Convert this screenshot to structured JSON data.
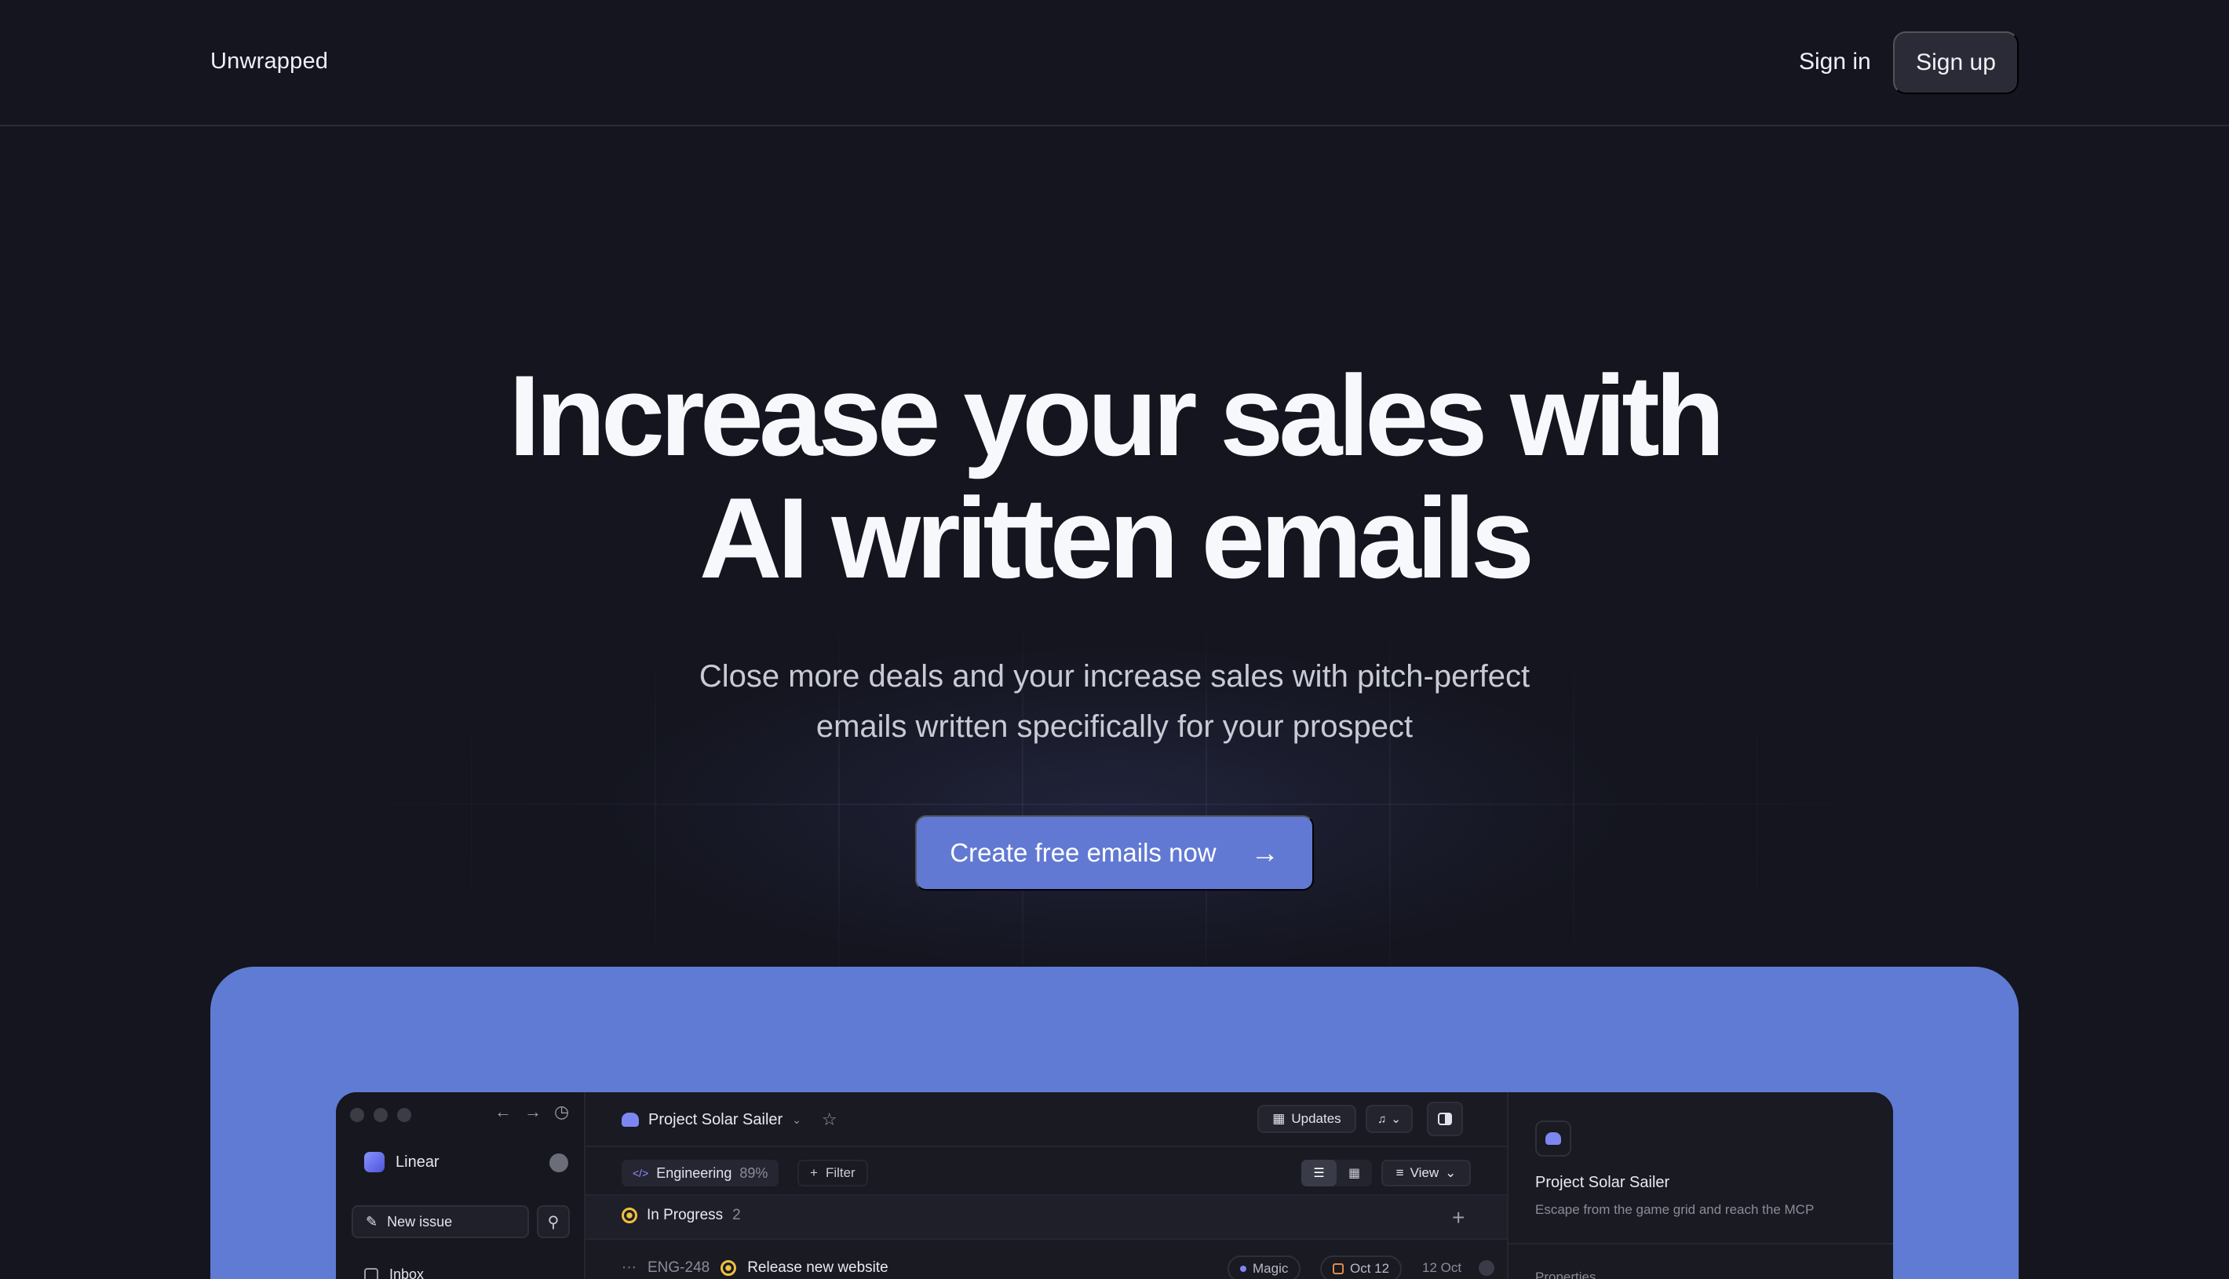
{
  "header": {
    "brand": "Unwrapped",
    "sign_in": "Sign in",
    "sign_up": "Sign up"
  },
  "hero": {
    "headline_line1": "Increase your sales with",
    "headline_line2": "AI written emails",
    "subhead_line1": "Close more deals and your increase sales with pitch-perfect",
    "subhead_line2": "emails written specifically for your prospect",
    "cta_label": "Create free emails now",
    "cta_icon": "arrow-right-icon"
  },
  "colors": {
    "background": "#14151f",
    "accent": "#6179d3",
    "showcase": "#5f7bd3"
  },
  "app": {
    "sidebar": {
      "workspace": "Linear",
      "new_issue": "New issue",
      "inbox": "Inbox"
    },
    "topbar": {
      "project": "Project Solar Sailer",
      "updates": "Updates"
    },
    "filterbar": {
      "team": "Engineering",
      "team_pct": "89%",
      "filter": "Filter",
      "view": "View"
    },
    "group": {
      "label": "In Progress",
      "count": "2"
    },
    "issue": {
      "id": "ENG-248",
      "title": "Release new website",
      "label": "Magic",
      "due": "Oct 12",
      "created": "12 Oct"
    },
    "panel": {
      "title": "Project Solar Sailer",
      "description": "Escape from the game grid and reach the MCP",
      "properties": "Properties"
    }
  }
}
